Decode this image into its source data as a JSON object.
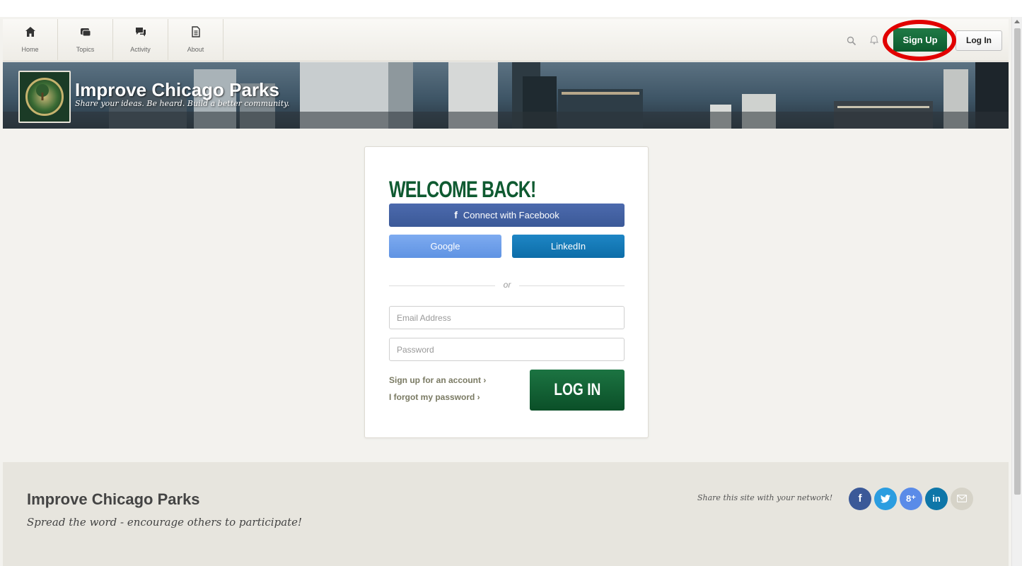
{
  "nav": {
    "items": [
      {
        "label": "Home",
        "icon": "home-icon"
      },
      {
        "label": "Topics",
        "icon": "topics-icon"
      },
      {
        "label": "Activity",
        "icon": "activity-icon"
      },
      {
        "label": "About",
        "icon": "about-icon"
      }
    ],
    "signup_label": "Sign Up",
    "login_label": "Log In"
  },
  "banner": {
    "title": "Improve Chicago Parks",
    "tagline": "Share your ideas. Be heard. Build a better community."
  },
  "login_card": {
    "heading": "WELCOME BACK!",
    "facebook_label": "Connect with Facebook",
    "google_label": "Google",
    "linkedin_label": "LinkedIn",
    "or_label": "or",
    "email_placeholder": "Email Address",
    "password_placeholder": "Password",
    "signup_link": "Sign up for an account ›",
    "forgot_link": "I forgot my password ›",
    "login_button": "LOG IN"
  },
  "footer": {
    "title": "Improve Chicago Parks",
    "subtitle": "Spread the word - encourage others to participate!",
    "share_text": "Share this site with your network!",
    "social": [
      {
        "name": "facebook-icon",
        "glyph": "f",
        "color": "#3b5998"
      },
      {
        "name": "twitter-icon",
        "glyph": "",
        "color": "#2b9de0"
      },
      {
        "name": "google-plus-icon",
        "glyph": "8⁺",
        "color": "#5a8be8"
      },
      {
        "name": "linkedin-icon",
        "glyph": "in",
        "color": "#0e76a8"
      },
      {
        "name": "email-icon",
        "glyph": "",
        "color": "#d6d3c8"
      }
    ]
  },
  "colors": {
    "brand_green": "#0f5a31",
    "highlight_red": "#e10000",
    "facebook_blue": "#3b5998",
    "linkedin_blue": "#0e76a8"
  }
}
